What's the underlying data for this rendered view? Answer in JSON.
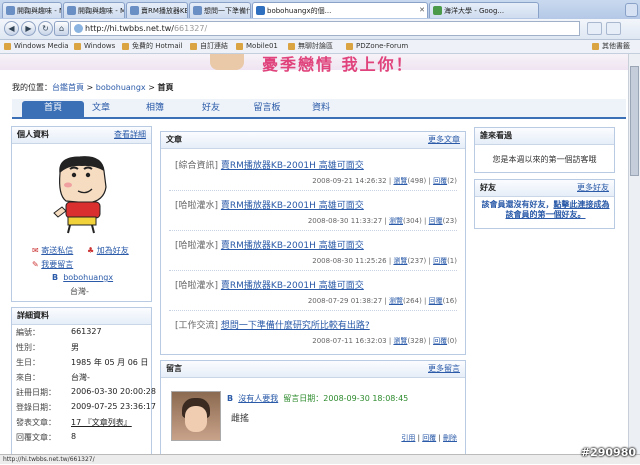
{
  "browser": {
    "tabs": [
      {
        "label": "開鞠與趣味 - M..."
      },
      {
        "label": "開鞠與趣味 - Mo..."
      },
      {
        "label": "賣RM播放器KB..."
      },
      {
        "label": "想問一下準備什..."
      },
      {
        "label": "bobohuangx的個..."
      },
      {
        "label": "海洋大學 - Goog..."
      }
    ],
    "url_host": "http://hi.twbbs.net.tw/",
    "url_path": "661327/",
    "bookmarks": [
      "Windows Media",
      "Windows",
      "免費的 Hotmail",
      "自訂連結",
      "Mobile01",
      "無聊討論區",
      "PDZone-Forum"
    ],
    "other_bookmarks": "其他書籤",
    "status_url": "http://hi.twbbs.net.tw/661327/"
  },
  "banner": {
    "slogan": "憂季戀情 我上你！"
  },
  "breadcrumb": {
    "prefix": "我的位置：",
    "home": "台鑑首頁",
    "sep1": " > ",
    "user": "bobohuangx",
    "sep2": " > ",
    "current": "首頁"
  },
  "nav_tabs": [
    "首頁",
    "文章",
    "相簿",
    "好友",
    "留言板",
    "資料"
  ],
  "profile": {
    "title": "個人資料",
    "more": "查看詳細",
    "send_msg": "寄送私信",
    "add_friend": "加為好友",
    "leave_msg": "我要留言",
    "badge": "B",
    "username": "bobohuangx",
    "location": "台灣-"
  },
  "details": {
    "title": "詳細資料",
    "rows": [
      {
        "label": "編號：",
        "value": "661327"
      },
      {
        "label": "性別：",
        "value": "男"
      },
      {
        "label": "生日：",
        "value": "1985 年 05 月 06 日"
      },
      {
        "label": "來自：",
        "value": "台灣-"
      },
      {
        "label": "註冊日期：",
        "value": "2006-03-30 20:00:28"
      },
      {
        "label": "登錄日期：",
        "value": "2009-07-25 23:36:17"
      },
      {
        "label": "發表文章：",
        "value": "17 『文章列表』"
      },
      {
        "label": "回覆文章：",
        "value": "8"
      }
    ]
  },
  "articles": {
    "title": "文章",
    "more": "更多文章",
    "items": [
      {
        "category": "[綜合資訊]",
        "title": "賣RM播放器KB-2001H 高雄可面交",
        "date": "2008-09-21 14:26:32",
        "views_label": "瀏覽",
        "views": "(498)",
        "replies_label": "回覆",
        "replies": "(2)"
      },
      {
        "category": "[哈啦灌水]",
        "title": "賣RM播放器KB-2001H 高雄可面交",
        "date": "2008-08-30 11:33:27",
        "views_label": "瀏覽",
        "views": "(304)",
        "replies_label": "回覆",
        "replies": "(23)"
      },
      {
        "category": "[哈啦灌水]",
        "title": "賣RM播放器KB-2001H 高雄可面交",
        "date": "2008-08-30 11:25:26",
        "views_label": "瀏覽",
        "views": "(237)",
        "replies_label": "回覆",
        "replies": "(1)"
      },
      {
        "category": "[哈啦灌水]",
        "title": "賣RM播放器KB-2001H 高雄可面交",
        "date": "2008-07-29 01:38:27",
        "views_label": "瀏覽",
        "views": "(264)",
        "replies_label": "回覆",
        "replies": "(16)"
      },
      {
        "category": "[工作交流]",
        "title": "想問一下準備什麼研究所比較有出路?",
        "date": "2008-07-11 16:32:03",
        "views_label": "瀏覽",
        "views": "(328)",
        "replies_label": "回覆",
        "replies": "(0)"
      }
    ]
  },
  "messages": {
    "title": "留言",
    "more": "更多留言",
    "items": [
      {
        "badge": "B",
        "author": "沒有人要我",
        "date_label": "留言日期：",
        "date": "2008-09-30 18:08:45",
        "text": "雌搖",
        "actions": [
          "引用",
          "回覆",
          "刪除"
        ]
      }
    ]
  },
  "visitors": {
    "title": "誰來看過",
    "text": "您是本週以來的第一個訪客哦"
  },
  "friends": {
    "title": "好友",
    "more": "更多好友",
    "text_prefix": "該會員還沒有好友，",
    "text_link": "點擊此連接成為該會員的第一個好友。"
  },
  "watermark": "#290980"
}
